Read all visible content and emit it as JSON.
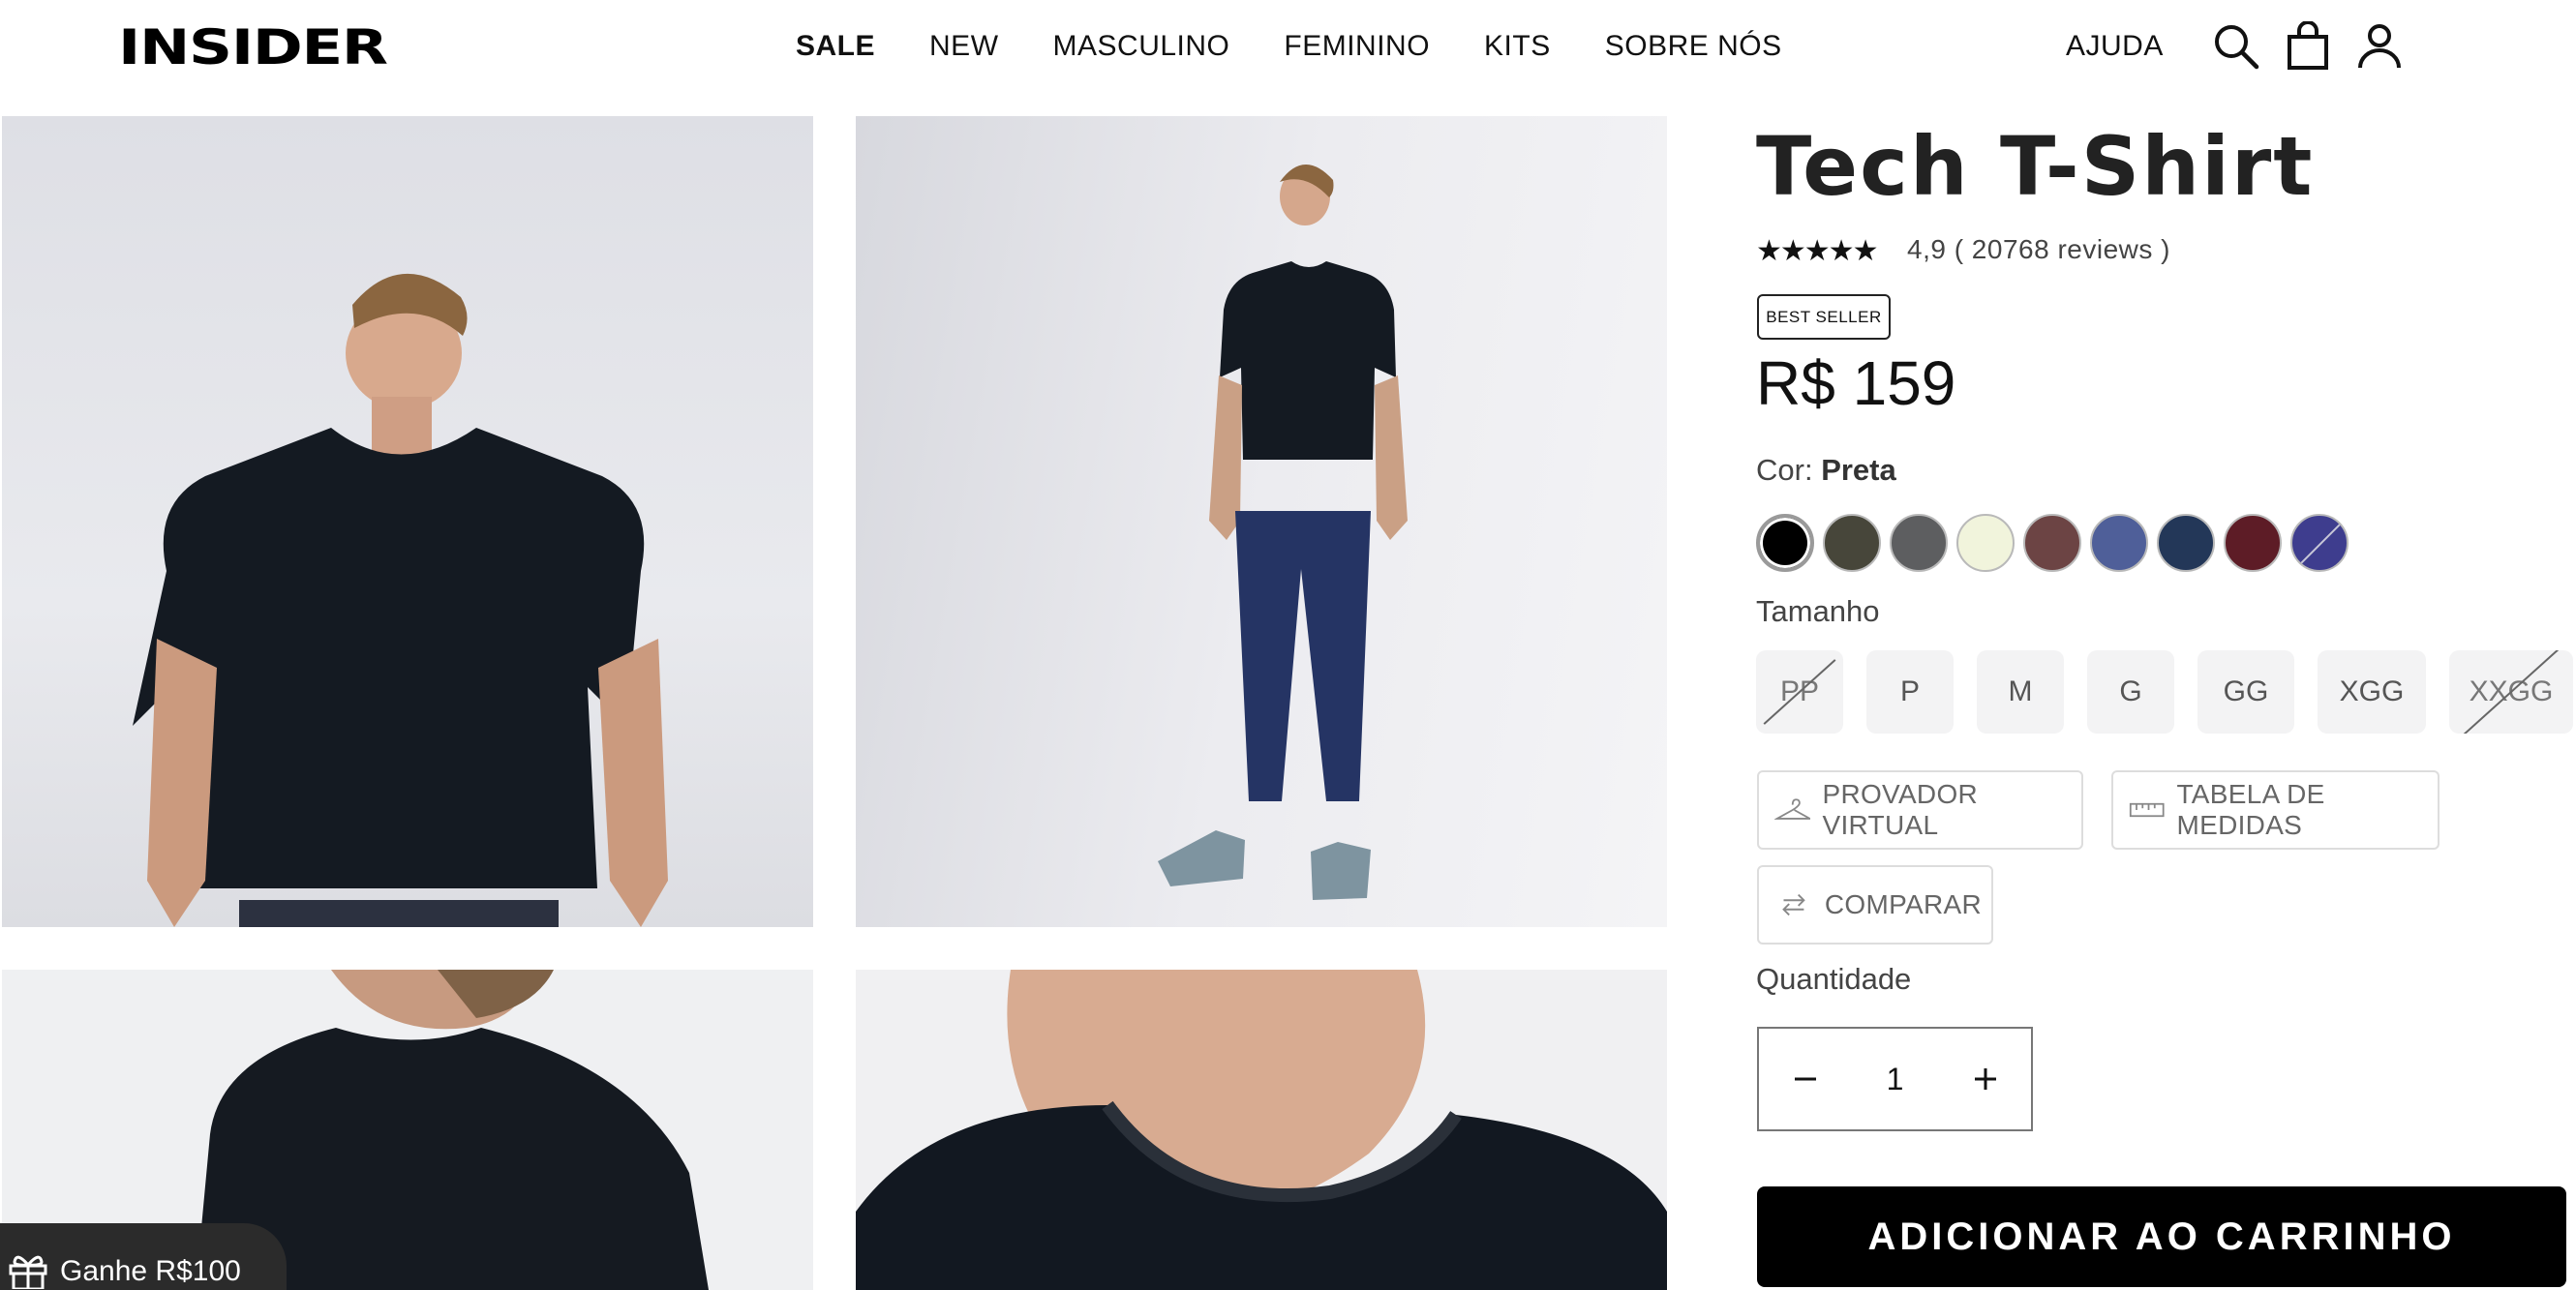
{
  "header": {
    "logo": "INSIDER",
    "nav": [
      "SALE",
      "NEW",
      "MASCULINO",
      "FEMININO",
      "KITS",
      "SOBRE NÓS"
    ],
    "help": "AJUDA",
    "icons": [
      "search-icon",
      "shopping-bag-icon",
      "user-icon"
    ]
  },
  "promo": {
    "text": "Ganhe R$100",
    "icon": "gift-icon"
  },
  "product": {
    "title": "Tech T-Shirt",
    "stars": "★★★★★",
    "rating": "4,9 ( 20768 reviews )",
    "badge": "BEST SELLER",
    "price": "R$ 159",
    "color_label": "Cor: ",
    "color_value": "Preta",
    "colors": [
      "#000000",
      "#47463a",
      "#5d5e60",
      "#f1f4dc",
      "#6c4444",
      "#4f5f99",
      "#233758",
      "#5d1c26",
      "#3e3d8e"
    ],
    "size_label": "Tamanho",
    "sizes": [
      {
        "label": "PP",
        "available": false
      },
      {
        "label": "P",
        "available": true
      },
      {
        "label": "M",
        "available": true
      },
      {
        "label": "G",
        "available": true
      },
      {
        "label": "GG",
        "available": true
      },
      {
        "label": "XGG",
        "available": true
      },
      {
        "label": "XXGG",
        "available": false
      }
    ],
    "virtual_fitting": "PROVADOR VIRTUAL",
    "size_chart": "TABELA DE MEDIDAS",
    "compare": "COMPARAR",
    "quantity_label": "Quantidade",
    "quantity": "1",
    "add_to_cart": "ADICIONAR AO CARRINHO"
  }
}
